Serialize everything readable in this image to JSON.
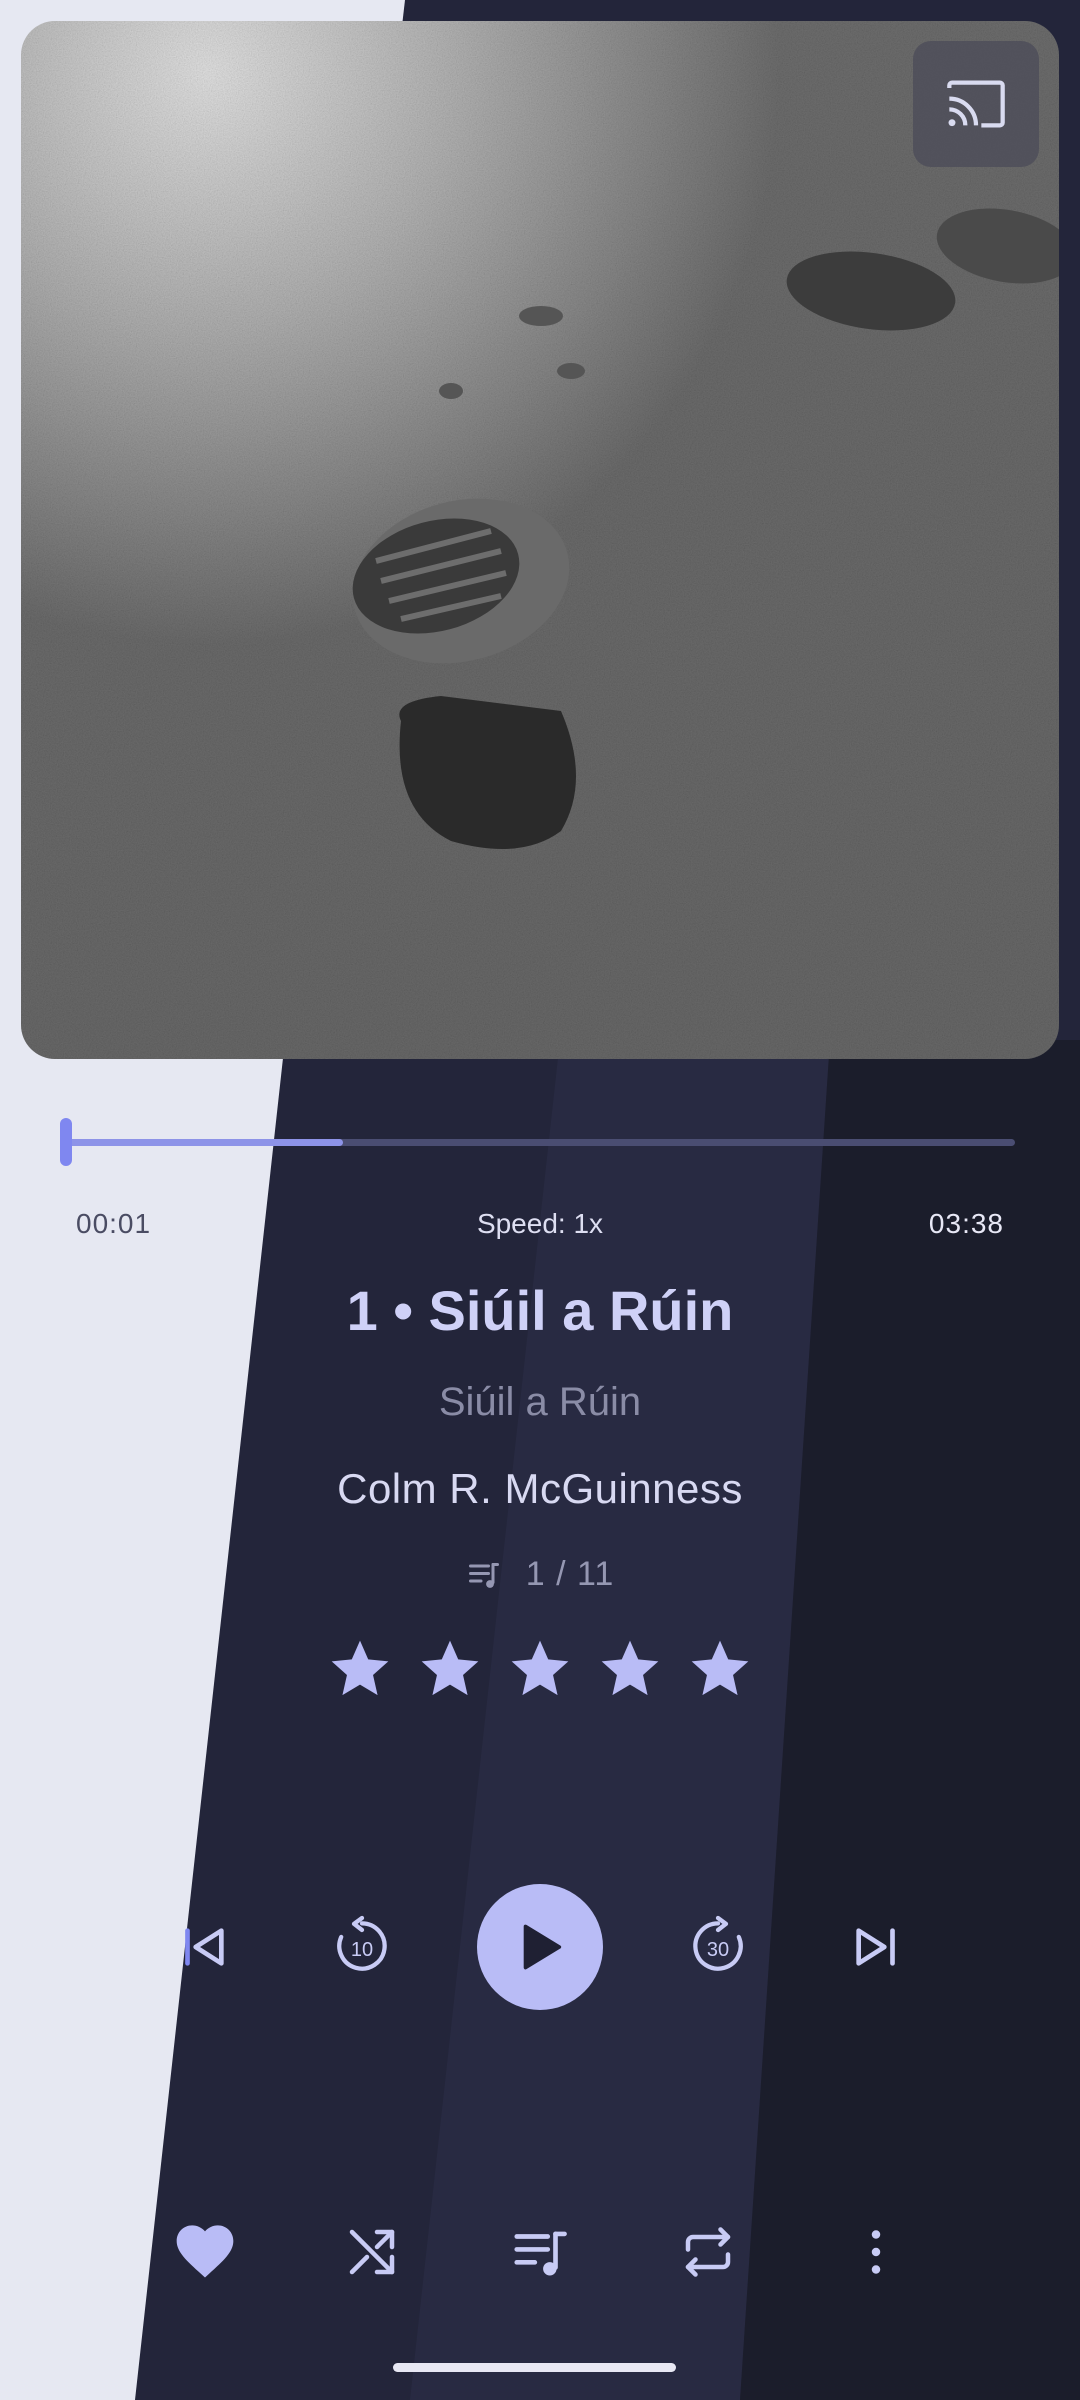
{
  "player": {
    "current_time": "00:01",
    "total_time": "03:38",
    "speed_label": "Speed: 1x",
    "progress_fraction": 0.0,
    "buffered_fraction": 0.3
  },
  "track": {
    "title": "1 • Siúil a Rúin",
    "album": "Siúil a Rúin",
    "artist": "Colm R. McGuinness",
    "queue_position": "1 / 11",
    "rating_stars": 5
  },
  "icons": {
    "cast": "cast-icon",
    "queue_indicator": "playlist-music-icon",
    "previous": "skip-previous-icon",
    "rewind": "replay-10-icon",
    "play": "play-icon",
    "forward": "forward-30-icon",
    "next": "skip-next-icon",
    "favorite": "heart-icon",
    "shuffle": "shuffle-icon",
    "queue": "queue-music-icon",
    "repeat": "repeat-icon",
    "more": "more-vertical-icon"
  },
  "colors": {
    "accent": "#b9bcf6",
    "seek_thumb": "#7f87f0",
    "background_dark": "#1c1d2a",
    "background_light": "#e6e8f2"
  }
}
